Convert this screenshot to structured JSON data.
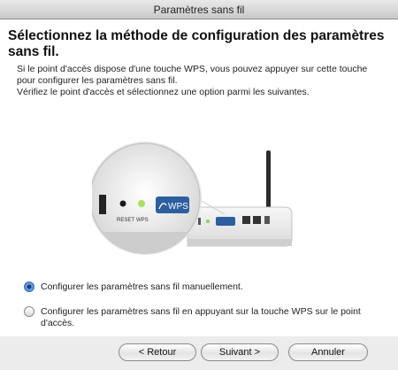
{
  "window": {
    "title": "Paramètres sans fil"
  },
  "heading": "Sélectionnez la méthode de configuration des paramètres sans fil.",
  "description": [
    "Si le point d'accès dispose d'une touche WPS, vous pouvez appuyer sur cette touche pour configurer les paramètres sans fil.",
    "Vérifiez le point d'accès et sélectionnez une option parmi les suivantes."
  ],
  "illustration": {
    "reset_label": "RESET",
    "wps_label": "WPS",
    "wps_button_label": "WPS"
  },
  "options": [
    {
      "label": "Configurer les paramètres sans fil manuellement.",
      "selected": true
    },
    {
      "label": "Configurer les paramètres sans fil en appuyant sur la touche WPS sur le point d'accès.",
      "selected": false
    }
  ],
  "buttons": {
    "back": "< Retour",
    "next": "Suivant >",
    "cancel": "Annuler"
  }
}
